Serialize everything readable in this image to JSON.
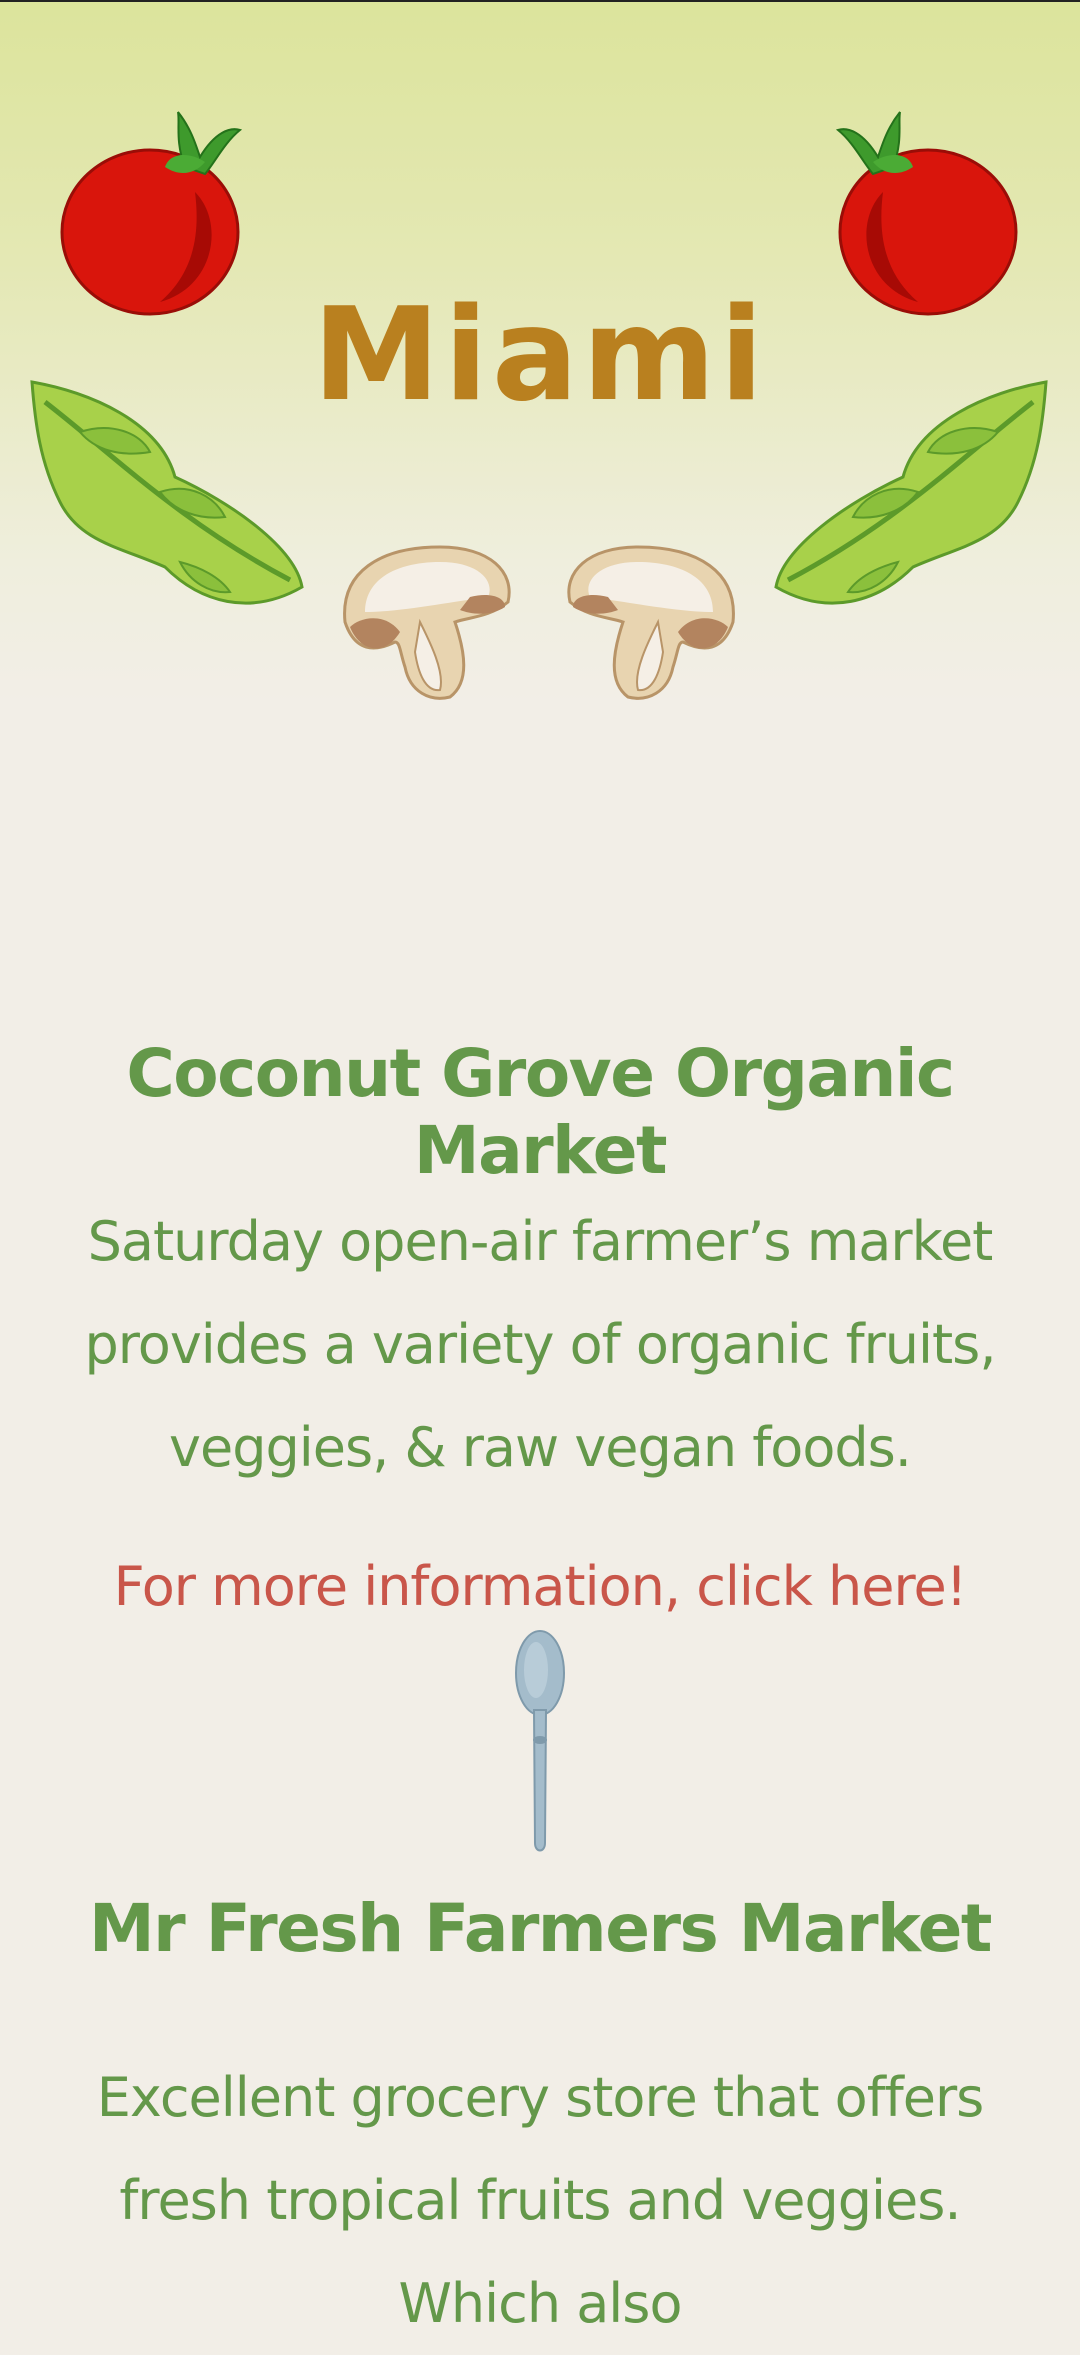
{
  "city": {
    "title": "Miami"
  },
  "decorations": {
    "icons": [
      "tomato-icon",
      "basil-leaf-icon",
      "mushroom-icon",
      "spoon-icon"
    ],
    "colors": {
      "title": "#b9801f",
      "heading": "#64984a",
      "link": "#c9564a",
      "tomato": "#d9150c",
      "leaf": "#a8d14a",
      "mushroom": "#e8d4b0",
      "spoon": "#a4bccb",
      "background": "#f2eee7"
    }
  },
  "markets": [
    {
      "name": "Coconut Grove Organic Market",
      "description": "Saturday open-air farmer’s market provides a variety of organic fruits, veggies, & raw vegan foods.",
      "link_text": "For more information, click here!"
    },
    {
      "name": "Mr Fresh Farmers Market",
      "description": "Excellent grocery store that offers fresh tropical fruits and veggies. Which also"
    }
  ]
}
